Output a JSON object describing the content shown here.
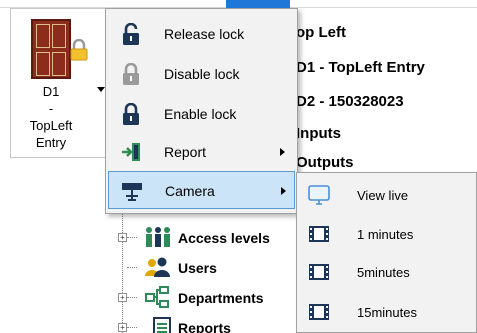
{
  "door": {
    "label": "D1\n-\nTopLeft\nEntry"
  },
  "right_panel": {
    "items": [
      "op Left",
      "D1 - TopLeft Entry",
      "D2 - 150328023",
      "Inputs",
      "Outputs"
    ]
  },
  "context_menu": {
    "items": [
      {
        "label": "Release lock",
        "icon": "lock-open-icon"
      },
      {
        "label": "Disable lock",
        "icon": "lock-disabled-icon"
      },
      {
        "label": "Enable lock",
        "icon": "lock-closed-icon"
      },
      {
        "label": "Report",
        "icon": "report-exit-icon",
        "has_submenu": true
      },
      {
        "label": "Camera",
        "icon": "camera-icon",
        "has_submenu": true,
        "highlighted": true
      }
    ]
  },
  "camera_submenu": {
    "items": [
      {
        "label": "View live",
        "icon": "monitor-icon"
      },
      {
        "label": "1 minutes",
        "icon": "film-icon"
      },
      {
        "label": "5minutes",
        "icon": "film-icon"
      },
      {
        "label": "15minutes",
        "icon": "film-icon"
      }
    ]
  },
  "tree": {
    "items": [
      {
        "label": "Access levels",
        "icon": "access-levels-icon",
        "expandable": true
      },
      {
        "label": "Users",
        "icon": "users-icon",
        "expandable": false
      },
      {
        "label": "Departments",
        "icon": "departments-icon",
        "expandable": true
      },
      {
        "label": "Reports",
        "icon": "reports-icon",
        "expandable": true
      }
    ]
  },
  "colors": {
    "menu_bg": "#f2f2f2",
    "highlight_bg": "#cce4f7",
    "highlight_border": "#5a9ad8",
    "icon_navy": "#1d3557",
    "icon_gray": "#9a9a9a"
  }
}
